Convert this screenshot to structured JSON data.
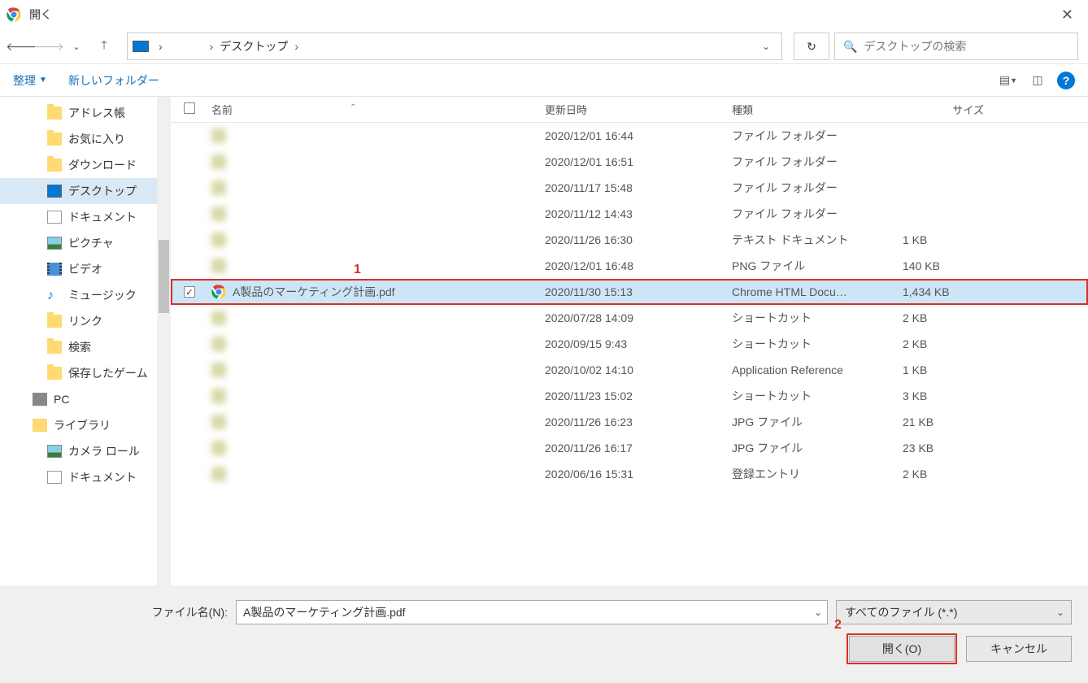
{
  "window": {
    "title": "開く"
  },
  "nav": {
    "crumb_user_blur": "　　　",
    "crumb_desktop": "デスクトップ",
    "search_placeholder": "デスクトップの検索"
  },
  "toolbar": {
    "organize": "整理",
    "newfolder": "新しいフォルダー"
  },
  "sidebar": [
    {
      "label": "アドレス帳",
      "icon": "folder",
      "indent": true
    },
    {
      "label": "お気に入り",
      "icon": "folder",
      "indent": true
    },
    {
      "label": "ダウンロード",
      "icon": "folder",
      "indent": true
    },
    {
      "label": "デスクトップ",
      "icon": "monitor",
      "indent": true,
      "selected": true
    },
    {
      "label": "ドキュメント",
      "icon": "doc",
      "indent": true
    },
    {
      "label": "ピクチャ",
      "icon": "photo",
      "indent": true
    },
    {
      "label": "ビデオ",
      "icon": "video",
      "indent": true
    },
    {
      "label": "ミュージック",
      "icon": "music",
      "indent": true
    },
    {
      "label": "リンク",
      "icon": "folder",
      "indent": true
    },
    {
      "label": "検索",
      "icon": "folder",
      "indent": true
    },
    {
      "label": "保存したゲーム",
      "icon": "folder",
      "indent": true
    },
    {
      "label": "PC",
      "icon": "pc",
      "indent": false
    },
    {
      "label": "ライブラリ",
      "icon": "lib",
      "indent": false
    },
    {
      "label": "カメラ ロール",
      "icon": "photo",
      "indent": true
    },
    {
      "label": "ドキュメント",
      "icon": "doc",
      "indent": true
    }
  ],
  "columns": {
    "name": "名前",
    "date": "更新日時",
    "type": "種類",
    "size": "サイズ"
  },
  "files": [
    {
      "name": "　　　",
      "date": "2020/12/01 16:44",
      "type": "ファイル フォルダー",
      "size": "",
      "blur": true
    },
    {
      "name": "　　　　　　　",
      "date": "2020/12/01 16:51",
      "type": "ファイル フォルダー",
      "size": "",
      "blur": true
    },
    {
      "name": "　　　　",
      "date": "2020/11/17 15:48",
      "type": "ファイル フォルダー",
      "size": "",
      "blur": true
    },
    {
      "name": "　　　　",
      "date": "2020/11/12 14:43",
      "type": "ファイル フォルダー",
      "size": "",
      "blur": true
    },
    {
      "name": "　　　　　　　　　　　　　",
      "date": "2020/11/26 16:30",
      "type": "テキスト ドキュメント",
      "size": "1 KB",
      "blur": true
    },
    {
      "name": "　　　　　　　",
      "date": "2020/12/01 16:48",
      "type": "PNG ファイル",
      "size": "140 KB",
      "blur": true
    },
    {
      "name": "A製品のマーケティング計画.pdf",
      "date": "2020/11/30 15:13",
      "type": "Chrome HTML Docu…",
      "size": "1,434 KB",
      "blur": false,
      "selected": true,
      "checked": true,
      "chrome": true
    },
    {
      "name": "　　　　　　",
      "date": "2020/07/28 14:09",
      "type": "ショートカット",
      "size": "2 KB",
      "blur": true
    },
    {
      "name": "　　",
      "date": "2020/09/15 9:43",
      "type": "ショートカット",
      "size": "2 KB",
      "blur": true
    },
    {
      "name": "　　　　　　　　　　　　　",
      "date": "2020/10/02 14:10",
      "type": "Application Reference",
      "size": "1 KB",
      "blur": true
    },
    {
      "name": "　　　　　",
      "date": "2020/11/23 15:02",
      "type": "ショートカット",
      "size": "3 KB",
      "blur": true
    },
    {
      "name": "　　　　　",
      "date": "2020/11/26 16:23",
      "type": "JPG ファイル",
      "size": "21 KB",
      "blur": true
    },
    {
      "name": "　　　　　　",
      "date": "2020/11/26 16:17",
      "type": "JPG ファイル",
      "size": "23 KB",
      "blur": true
    },
    {
      "name": "　　　　　　　　",
      "date": "2020/06/16 15:31",
      "type": "登録エントリ",
      "size": "2 KB",
      "blur": true
    }
  ],
  "bottom": {
    "filename_label": "ファイル名(N):",
    "filename_value": "A製品のマーケティング計画.pdf",
    "filter": "すべてのファイル (*.*)",
    "open": "開く(O)",
    "cancel": "キャンセル"
  },
  "annotations": {
    "n1": "1",
    "n2": "2"
  }
}
